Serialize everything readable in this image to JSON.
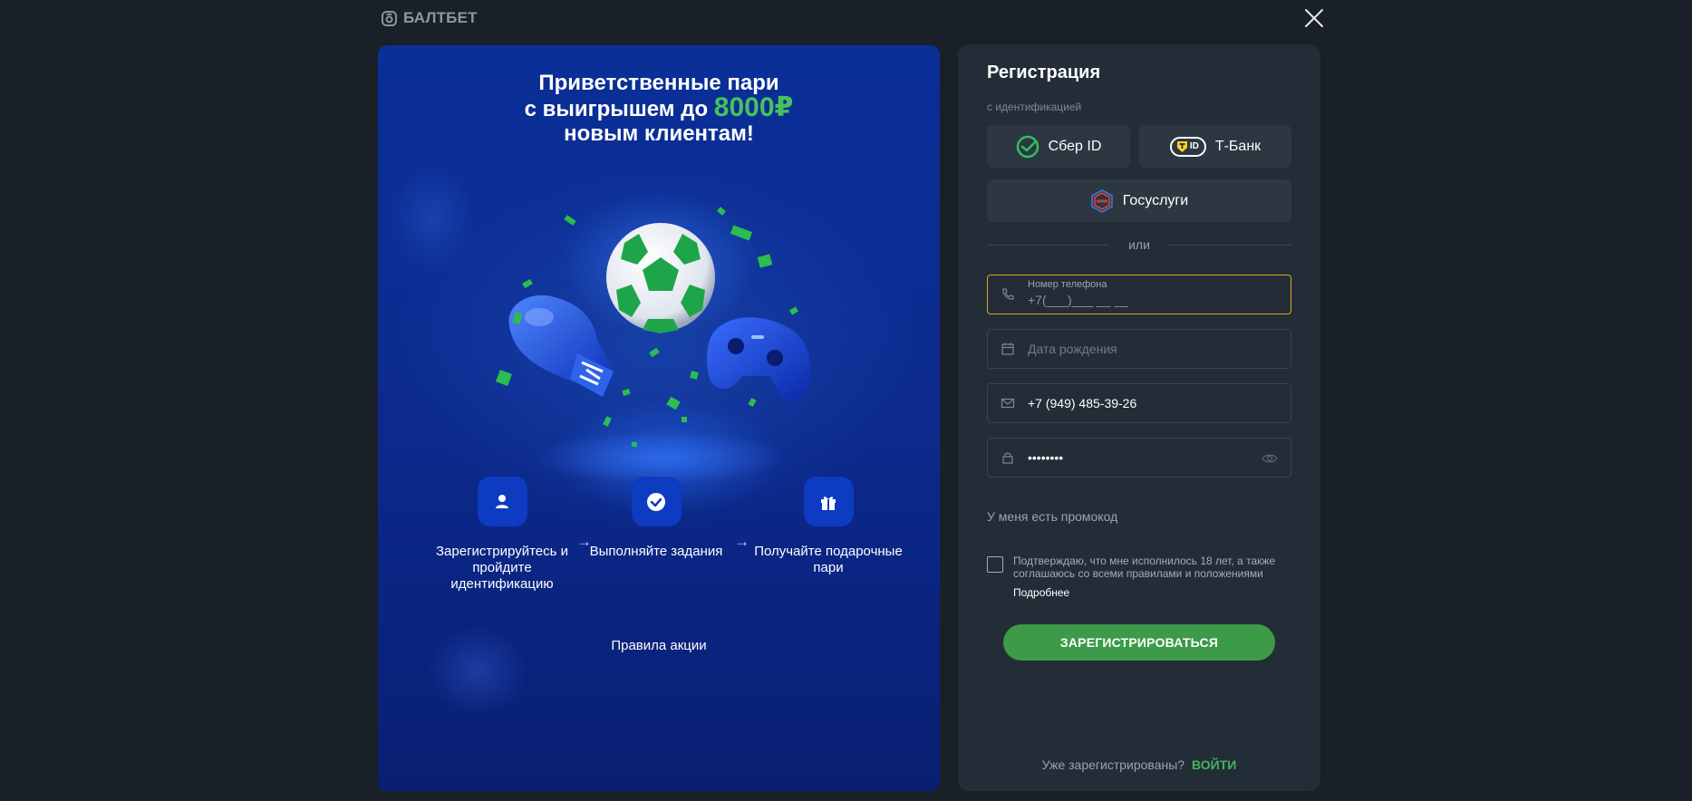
{
  "header": {
    "brand": "БАЛТБЕТ"
  },
  "promo": {
    "title_line1": "Приветственные пари",
    "title_line2_prefix": "с выигрышем до",
    "title_amount": "8000₽",
    "title_line3": "новым клиентам!",
    "steps": [
      {
        "icon": "user-icon",
        "text": "Зарегистрируйтесь и пройдите идентификацию"
      },
      {
        "icon": "check-circle-icon",
        "text": "Выполняйте задания"
      },
      {
        "icon": "gift-icon",
        "text": "Получайте подарочные пари"
      }
    ],
    "step_arrow": "→",
    "rules_link": "Правила акции"
  },
  "form": {
    "title": "Регистрация",
    "id_subtitle": "с идентификацией",
    "sber_label": "Сбер ID",
    "tbank_label": "Т-Банк",
    "tbank_badge": "ID",
    "gosuslugi_label": "Госуслуги",
    "divider_text": "или",
    "phone": {
      "label": "Номер телефона",
      "placeholder": "+7(___)___ __ __"
    },
    "birthdate": {
      "placeholder": "Дата рождения"
    },
    "email": {
      "value": "+7 (949) 485-39-26"
    },
    "password": {
      "value": "••••••••"
    },
    "promo_code_link": "У меня есть промокод",
    "consent_text": "Подтверждаю, что мне исполнилось 18 лет, а также соглашаюсь со всеми правилами и положениями",
    "consent_more": "Подробнее",
    "submit_label": "ЗАРЕГИСТРИРОВАТЬСЯ",
    "already_registered": "Уже зарегистрированы?",
    "login_label": "ВОЙТИ"
  },
  "colors": {
    "background": "#1a2027",
    "panel": "#232d37",
    "accent_green": "#3c9a49",
    "promo_blue": "#0a2f97",
    "focus_border": "#d9a822"
  }
}
